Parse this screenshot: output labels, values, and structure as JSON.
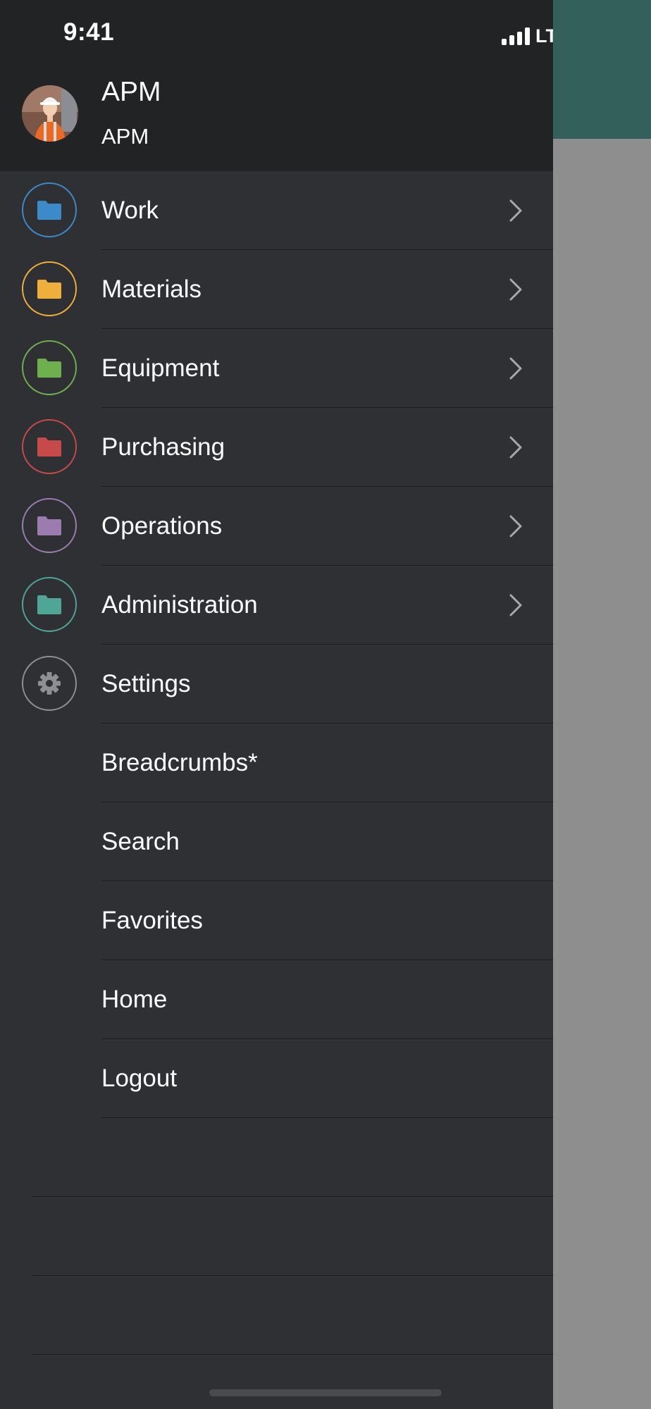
{
  "status_bar": {
    "time": "9:41",
    "network": "LTE"
  },
  "user": {
    "name": "APM",
    "role": "APM"
  },
  "colors": {
    "work": "#3c8ac9",
    "materials": "#f0ae3a",
    "equipment": "#6eb04e",
    "purchasing": "#c64a4a",
    "operations": "#9b7bb0",
    "administration": "#4fa596",
    "settings": "#8e8e93",
    "header_accent": "#33605a"
  },
  "menu": [
    {
      "label": "Work",
      "icon": "folder-icon"
    },
    {
      "label": "Materials",
      "icon": "folder-icon"
    },
    {
      "label": "Equipment",
      "icon": "folder-icon"
    },
    {
      "label": "Purchasing",
      "icon": "folder-icon"
    },
    {
      "label": "Operations",
      "icon": "folder-icon"
    },
    {
      "label": "Administration",
      "icon": "folder-icon"
    },
    {
      "label": "Settings",
      "icon": "gear-icon"
    },
    {
      "label": "Breadcrumbs*"
    },
    {
      "label": "Search"
    },
    {
      "label": "Favorites"
    },
    {
      "label": "Home"
    },
    {
      "label": "Logout"
    }
  ]
}
